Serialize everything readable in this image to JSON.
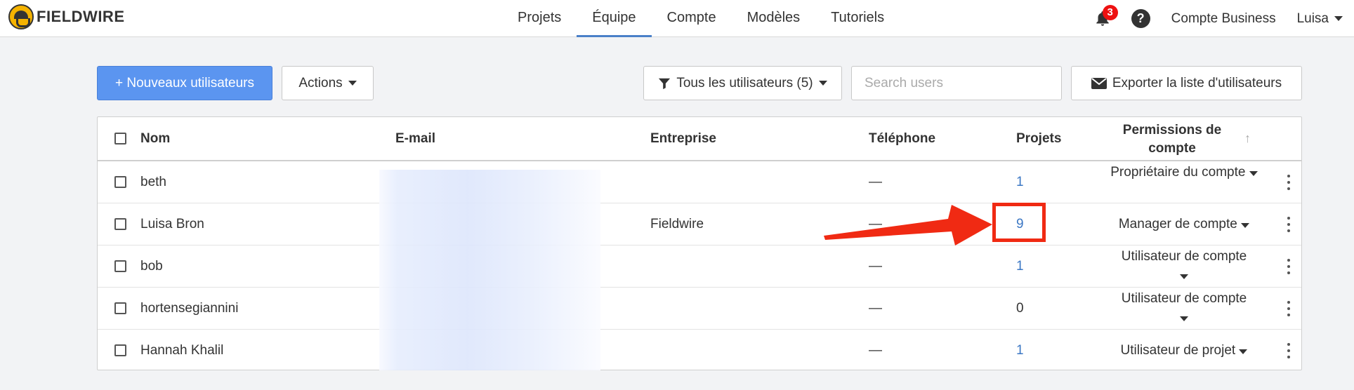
{
  "brand": {
    "name": "FIELDWIRE"
  },
  "nav": {
    "items": [
      {
        "label": "Projets",
        "active": false
      },
      {
        "label": "Équipe",
        "active": true
      },
      {
        "label": "Compte",
        "active": false
      },
      {
        "label": "Modèles",
        "active": false
      },
      {
        "label": "Tutoriels",
        "active": false
      }
    ]
  },
  "header": {
    "notifications_count": "3",
    "help_label": "?",
    "business_label": "Compte Business",
    "user_label": "Luisa"
  },
  "toolbar": {
    "new_users_label": "+ Nouveaux utilisateurs",
    "actions_label": "Actions",
    "filter_label": "Tous les utilisateurs (5)",
    "search_placeholder": "Search users",
    "export_label": "Exporter la liste d'utilisateurs"
  },
  "table": {
    "columns": {
      "name": "Nom",
      "email": "E-mail",
      "company": "Entreprise",
      "phone": "Téléphone",
      "projects": "Projets",
      "permissions": "Permissions de compte"
    },
    "rows": [
      {
        "name": "beth",
        "company": "",
        "phone": "—",
        "projects": "1",
        "permission": "Propriétaire du compte"
      },
      {
        "name": "Luisa Bron",
        "company": "Fieldwire",
        "phone": "—",
        "projects": "9",
        "permission": "Manager de compte"
      },
      {
        "name": "bob",
        "company": "",
        "phone": "—",
        "projects": "1",
        "permission": "Utilisateur de compte"
      },
      {
        "name": "hortensegiannini",
        "company": "",
        "phone": "—",
        "projects": "0",
        "permission": "Utilisateur de compte"
      },
      {
        "name": "Hannah Khalil",
        "company": "",
        "phone": "—",
        "projects": "1",
        "permission": "Utilisateur de projet"
      }
    ]
  },
  "colors": {
    "primary": "#5b95f0",
    "link": "#3b77c4",
    "annotation": "#f02a13",
    "badge": "#e11111"
  }
}
